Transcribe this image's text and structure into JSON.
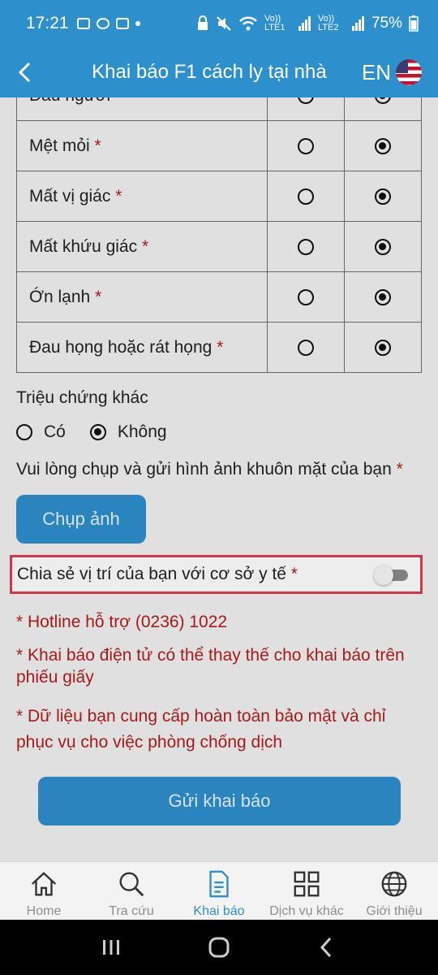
{
  "status_bar": {
    "time": "17:21",
    "signal_1": "Vo)) LTE1",
    "signal_2": "Vo)) LTE2",
    "battery": "75%"
  },
  "app_bar": {
    "title": "Khai báo F1 cách ly tại nhà",
    "language": "EN"
  },
  "symptoms": [
    {
      "label": "Đau người",
      "required": "*",
      "yes": false,
      "no": true
    },
    {
      "label": "Mệt mỏi",
      "required": "*",
      "yes": false,
      "no": true
    },
    {
      "label": "Mất vị giác",
      "required": "*",
      "yes": false,
      "no": true
    },
    {
      "label": "Mất khứu giác",
      "required": "*",
      "yes": false,
      "no": true
    },
    {
      "label": "Ớn lạnh",
      "required": "*",
      "yes": false,
      "no": true
    },
    {
      "label": "Đau họng hoặc rát họng",
      "required": "*",
      "yes": false,
      "no": true
    }
  ],
  "other_symptoms": {
    "label": "Triệu chứng khác",
    "option_yes": "Có",
    "option_no": "Không",
    "selected": "Không"
  },
  "photo": {
    "label": "Vui lòng chụp và gửi hình ảnh khuôn mặt của bạn",
    "required": "*",
    "button": "Chụp ảnh"
  },
  "location_share": {
    "label": "Chia sẻ vị trí của bạn với cơ sở y tế",
    "required": "*",
    "enabled": false
  },
  "notes": {
    "hotline": "* Hotline hỗ trợ (0236) 1022",
    "electronic": "* Khai báo điện tử có thể thay thế cho khai báo trên phiếu giấy",
    "privacy": "* Dữ liệu bạn cung cấp hoàn toàn bảo mật và chỉ phục vụ cho việc phòng chống dịch"
  },
  "submit_button": "Gửi khai báo",
  "bottom_nav": {
    "items": [
      {
        "label": "Home",
        "icon": "home-icon"
      },
      {
        "label": "Tra cứu",
        "icon": "search-icon"
      },
      {
        "label": "Khai báo",
        "icon": "document-icon",
        "active": true
      },
      {
        "label": "Dịch vụ khác",
        "icon": "grid-icon"
      },
      {
        "label": "Giới thiệu",
        "icon": "globe-icon"
      }
    ]
  },
  "colors": {
    "primary": "#2e8fcd",
    "required": "#b4191b",
    "highlight_border": "#e03b52"
  }
}
